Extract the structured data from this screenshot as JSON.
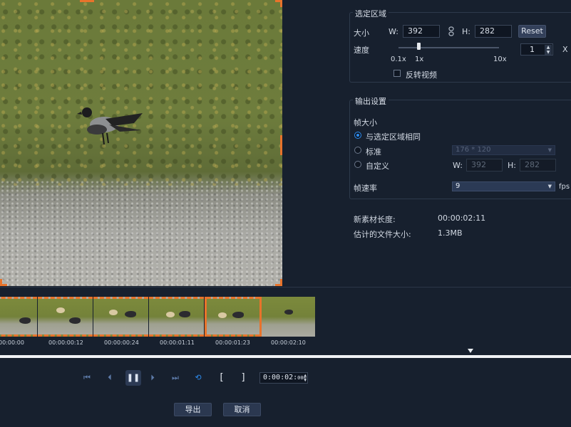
{
  "selection": {
    "title": "选定区域",
    "size_label": "大小",
    "w_label": "W:",
    "w_value": "392",
    "h_label": "H:",
    "h_value": "282",
    "reset_label": "Reset",
    "speed_label": "速度",
    "speed_marks": [
      "0.1x",
      "1x",
      "10x"
    ],
    "speed_value": "1",
    "speed_unit": "X",
    "reverse_label": "反转视频",
    "reverse_checked": false
  },
  "output": {
    "title": "输出设置",
    "frame_size_label": "帧大小",
    "options": [
      {
        "label": "与选定区域相同",
        "selected": true
      },
      {
        "label": "标准",
        "selected": false
      },
      {
        "label": "自定义",
        "selected": false
      }
    ],
    "standard_value": "176 * 120",
    "custom_w_label": "W:",
    "custom_w_value": "392",
    "custom_h_label": "H:",
    "custom_h_value": "282",
    "fps_label": "帧速率",
    "fps_value": "9",
    "fps_unit": "fps"
  },
  "info": {
    "length_label": "新素材长度:",
    "length_value": "00:00:02:11",
    "filesize_label": "估计的文件大小:",
    "filesize_value": "1.3MB"
  },
  "timeline": {
    "timecodes": [
      "00:00:00",
      "00:00:00:12",
      "00:00:00:24",
      "00:00:01:11",
      "00:00:01:23",
      "00:00:02:10"
    ]
  },
  "playback": {
    "time_main": "0:00:02:",
    "time_frames": "000",
    "mark_in": "[",
    "mark_out": "]"
  },
  "buttons": {
    "export_label": "导出",
    "cancel_label": "取消"
  },
  "colors": {
    "accent": "#2d8cf0",
    "crop_border": "#e8732b",
    "background": "#17202e"
  }
}
